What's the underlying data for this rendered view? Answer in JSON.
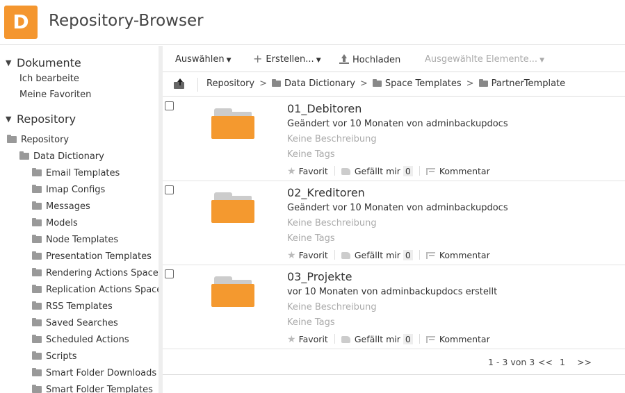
{
  "app": {
    "logo_letter": "D",
    "title": "Repository-Browser",
    "accent_color": "#f4962f"
  },
  "sidebar": {
    "dokumente": {
      "heading": "Dokumente",
      "links": [
        "Ich bearbeite",
        "Meine Favoriten"
      ]
    },
    "repository": {
      "heading": "Repository",
      "root": "Repository",
      "child": "Data Dictionary",
      "folders": [
        "Email Templates",
        "Imap Configs",
        "Messages",
        "Models",
        "Node Templates",
        "Presentation Templates",
        "Rendering Actions Space",
        "Replication Actions Space",
        "RSS Templates",
        "Saved Searches",
        "Scheduled Actions",
        "Scripts",
        "Smart Folder Downloads",
        "Smart Folder Templates"
      ]
    }
  },
  "toolbar": {
    "select_label": "Auswählen",
    "create_label": "Erstellen...",
    "upload_label": "Hochladen",
    "selected_items_label": "Ausgewählte Elemente..."
  },
  "breadcrumb": [
    "Repository",
    "Data Dictionary",
    "Space Templates",
    "PartnerTemplate"
  ],
  "items": [
    {
      "name": "01_Debitoren",
      "meta": "Geändert vor 10 Monaten von adminbackupdocs",
      "description": "Keine Beschreibung",
      "tags": "Keine Tags",
      "favorite_label": "Favorit",
      "like_label": "Gefällt mir",
      "like_count": "0",
      "comment_label": "Kommentar"
    },
    {
      "name": "02_Kreditoren",
      "meta": "Geändert vor 10 Monaten von adminbackupdocs",
      "description": "Keine Beschreibung",
      "tags": "Keine Tags",
      "favorite_label": "Favorit",
      "like_label": "Gefällt mir",
      "like_count": "0",
      "comment_label": "Kommentar"
    },
    {
      "name": "03_Projekte",
      "meta": "vor 10 Monaten von adminbackupdocs erstellt",
      "description": "Keine Beschreibung",
      "tags": "Keine Tags",
      "favorite_label": "Favorit",
      "like_label": "Gefällt mir",
      "like_count": "0",
      "comment_label": "Kommentar"
    }
  ],
  "pagination": {
    "summary": "1 - 3 von 3",
    "prev": "<<",
    "current": "1",
    "next": ">>"
  }
}
